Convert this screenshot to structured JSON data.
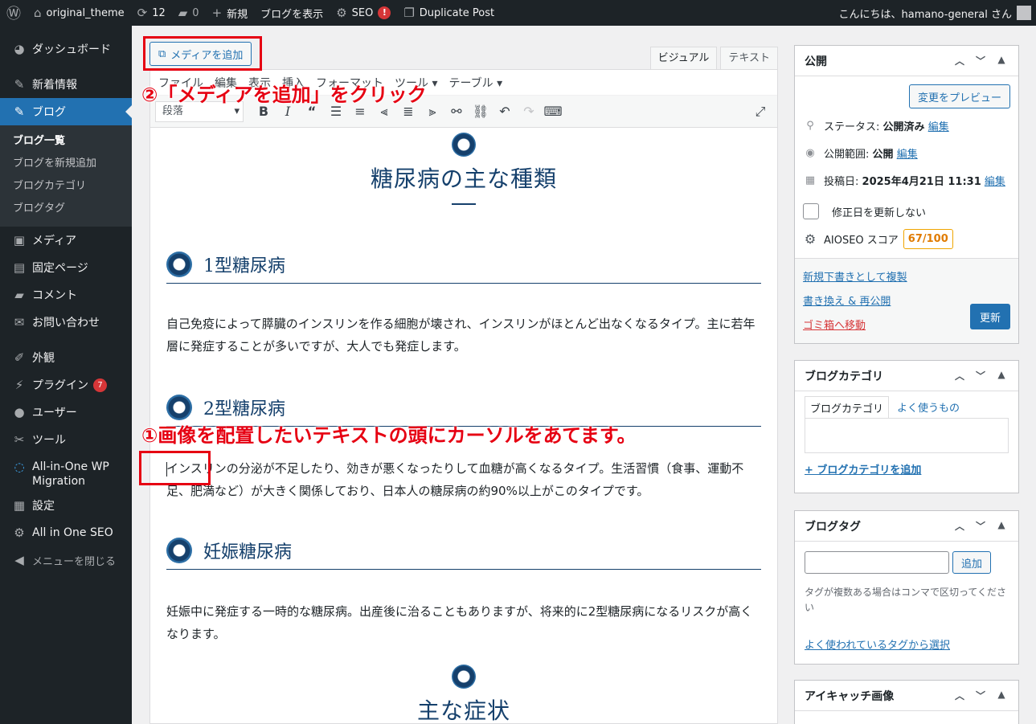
{
  "adminbar": {
    "site_name": "original_theme",
    "updates_count": "12",
    "comments_count": "0",
    "new_label": "新規",
    "view_blog": "ブログを表示",
    "seo_label": "SEO",
    "seo_badge": "!",
    "duplicate_post": "Duplicate Post",
    "greeting": "こんにちは、hamano-general さん"
  },
  "sidebar": {
    "dashboard": "ダッシュボード",
    "news": "新着情報",
    "blog": "ブログ",
    "blog_sub": [
      "ブログ一覧",
      "ブログを新規追加",
      "ブログカテゴリ",
      "ブログタグ"
    ],
    "media": "メディア",
    "pages": "固定ページ",
    "comments": "コメント",
    "contact": "お問い合わせ",
    "appearance": "外観",
    "plugins": "プラグイン",
    "plugins_badge": "7",
    "users": "ユーザー",
    "tools": "ツール",
    "migration": "All-in-One WP Migration",
    "settings": "設定",
    "aioseo": "All in One SEO",
    "collapse": "メニューを閉じる"
  },
  "editor": {
    "add_media": "メディアを追加",
    "tab_visual": "ビジュアル",
    "tab_text": "テキスト",
    "menubar": [
      "ファイル",
      "編集",
      "表示",
      "挿入",
      "フォーマット",
      "ツール ▾",
      "テーブル ▾"
    ],
    "format_select": "段落",
    "content": {
      "h2_1": "糖尿病の主な種類",
      "h3_1": "1型糖尿病",
      "p1": "自己免疫によって膵臓のインスリンを作る細胞が壊され、インスリンがほとんど出なくなるタイプ。主に若年層に発症することが多いですが、大人でも発症します。",
      "h3_2": "2型糖尿病",
      "p2": "インスリンの分泌が不足したり、効きが悪くなったりして血糖が高くなるタイプ。生活習慣（食事、運動不足、肥満など）が大きく関係しており、日本人の糖尿病の約90%以上がこのタイプです。",
      "h3_3": "妊娠糖尿病",
      "p3": "妊娠中に発症する一時的な糖尿病。出産後に治ることもありますが、将来的に2型糖尿病になるリスクが高くなります。",
      "h2_2": "主な症状"
    }
  },
  "publish": {
    "title": "公開",
    "preview": "変更をプレビュー",
    "status_label": "ステータス:",
    "status_value": "公開済み",
    "edit": "編集",
    "visibility_label": "公開範囲:",
    "visibility_value": "公開",
    "date_label": "投稿日:",
    "date_value": "2025年4月21日 11:31",
    "no_update_date": "修正日を更新しない",
    "aioseo_label": "AIOSEO スコア",
    "aioseo_score": "67/100",
    "new_draft": "新規下書きとして複製",
    "rewrite": "書き換え & 再公開",
    "trash": "ゴミ箱へ移動",
    "update": "更新"
  },
  "category": {
    "title": "ブログカテゴリ",
    "tab_all": "ブログカテゴリ",
    "tab_popular": "よく使うもの",
    "add": "+ ブログカテゴリを追加"
  },
  "tags": {
    "title": "ブログタグ",
    "add_btn": "追加",
    "hint": "タグが複数ある場合はコンマで区切ってください",
    "choose": "よく使われているタグから選択"
  },
  "featured": {
    "title": "アイキャッチ画像"
  },
  "annotations": {
    "step1": "①画像を配置したいテキストの頭にカーソルをあてます。",
    "step2": "②「メディアを追加」をクリック"
  },
  "colors": {
    "admin_dark": "#1d2327",
    "accent": "#2271b1",
    "heading": "#15406c",
    "annotation": "#e60012"
  }
}
